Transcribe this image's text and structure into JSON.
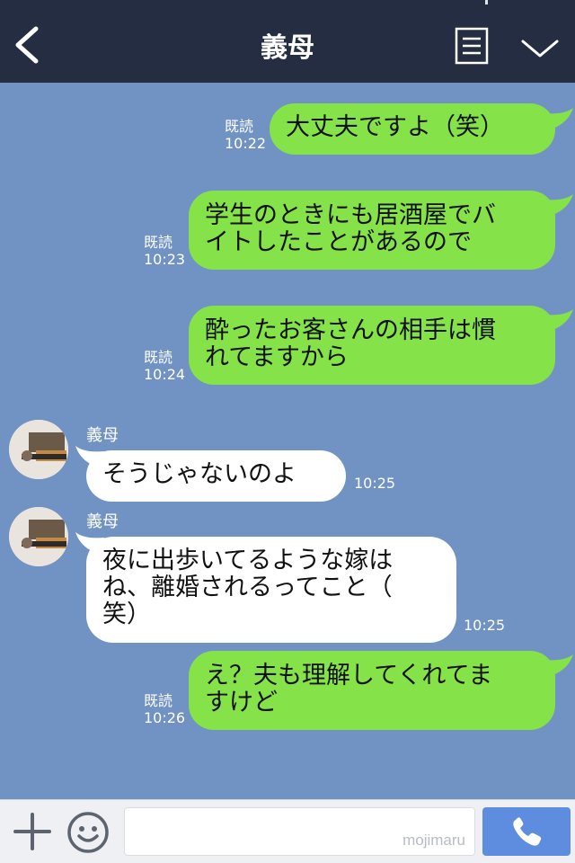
{
  "header": {
    "title": "義母",
    "back_icon": "chevron-left-icon",
    "menu_icon": "notes-icon",
    "collapse_icon": "chevron-down-icon"
  },
  "messages": [
    {
      "dir": "out",
      "lines": [
        "大丈夫ですよ（笑）"
      ],
      "status": "既読",
      "time": "10:22"
    },
    {
      "dir": "out",
      "lines": [
        "学生のときにも居酒屋でバ",
        "イトしたことがあるので"
      ],
      "status": "既読",
      "time": "10:23"
    },
    {
      "dir": "out",
      "lines": [
        "酔ったお客さんの相手は慣",
        "れてますから"
      ],
      "status": "既読",
      "time": "10:24"
    },
    {
      "dir": "in",
      "sender": "義母",
      "lines": [
        "そうじゃないのよ"
      ],
      "time": "10:25"
    },
    {
      "dir": "in",
      "sender": "義母",
      "lines": [
        "夜に出歩いてるような嫁は",
        "ね、離婚されるってこと（",
        "笑）"
      ],
      "time": "10:25"
    },
    {
      "dir": "out",
      "lines": [
        "え？夫も理解してくれてま",
        "すけど"
      ],
      "status": "既読",
      "time": "10:26"
    }
  ],
  "footer": {
    "plus_icon": "plus-icon",
    "emoji_icon": "smiley-icon",
    "input_value": "",
    "watermark": "mojimaru",
    "call_icon": "phone-icon"
  },
  "colors": {
    "header_bg": "#242d41",
    "chat_bg": "#7193c3",
    "outgoing_bubble": "#85e249",
    "incoming_bubble": "#ffffff",
    "call_button": "#5e8de0"
  }
}
